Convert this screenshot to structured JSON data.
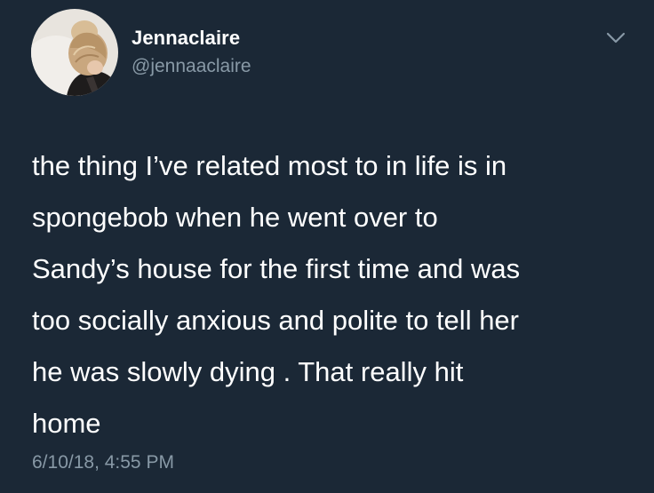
{
  "user": {
    "display_name": "Jennaclaire",
    "handle": "@jennaaclaire",
    "avatar_icon": "profile-photo"
  },
  "tweet": {
    "lines": [
      "the thing I’ve related most to in life is in",
      "spongebob when he went over to",
      "Sandy’s house for the first time and was",
      "too socially anxious and polite to tell her",
      "he was slowly dying . That really hit",
      "home"
    ],
    "timestamp": "6/10/18, 4:55 PM"
  },
  "menu": {
    "icon": "chevron-down-icon"
  },
  "colors": {
    "background": "#1b2836",
    "primary_text": "#ffffff",
    "secondary_text": "#8899a6"
  }
}
